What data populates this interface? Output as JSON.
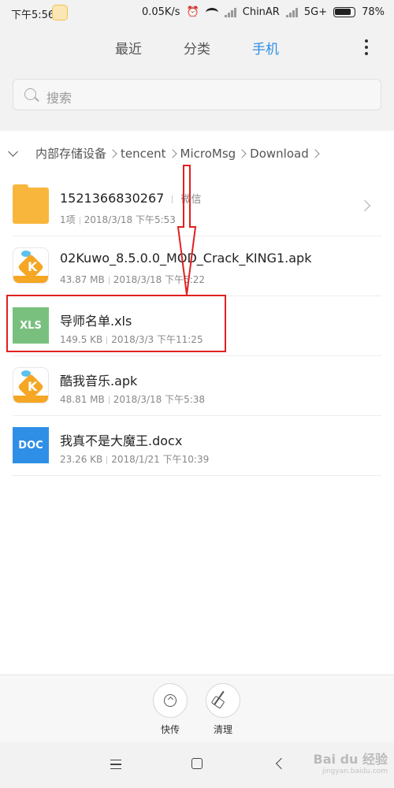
{
  "status_bar": {
    "time": "下午5:56",
    "speed": "0.05K/s",
    "carrier": "ChinAR",
    "network": "5G+",
    "battery": "78%"
  },
  "tabs": [
    {
      "label": "最近",
      "active": false
    },
    {
      "label": "分类",
      "active": false
    },
    {
      "label": "手机",
      "active": true
    }
  ],
  "search": {
    "placeholder": "搜索"
  },
  "breadcrumb": [
    "内部存储设备",
    "tencent",
    "MicroMsg",
    "Download"
  ],
  "files": [
    {
      "name": "1521366830267",
      "source": "微信",
      "size": "1项",
      "date": "2018/3/18 下午5:53",
      "icon": "folder-icon",
      "icon_text": ""
    },
    {
      "name": "02Kuwo_8.5.0.0_MOD_Crack_KING1.apk",
      "size": "43.87 MB",
      "date": "2018/3/18 下午5:22",
      "icon": "kuwo-app-icon",
      "icon_text": ""
    },
    {
      "name": "导师名单.xls",
      "size": "149.5 KB",
      "date": "2018/3/3 下午11:25",
      "icon": "xls-icon",
      "icon_text": "XLS"
    },
    {
      "name": "酷我音乐.apk",
      "size": "48.81 MB",
      "date": "2018/3/18 下午5:38",
      "icon": "kuwo-app-icon",
      "icon_text": ""
    },
    {
      "name": "我真不是大魔王.docx",
      "size": "23.26 KB",
      "date": "2018/1/21 下午10:39",
      "icon": "doc-icon",
      "icon_text": "DOC"
    }
  ],
  "actions": [
    {
      "label": "快传",
      "icon": "share-icon"
    },
    {
      "label": "清理",
      "icon": "broom-icon"
    }
  ],
  "watermark": {
    "text": "Bai du 经验",
    "sub": "jingyan.baidu.com"
  },
  "colors": {
    "accent": "#2f8fe6",
    "annotation": "#e02020",
    "folder": "#f9b63c",
    "xls": "#79c07e"
  }
}
